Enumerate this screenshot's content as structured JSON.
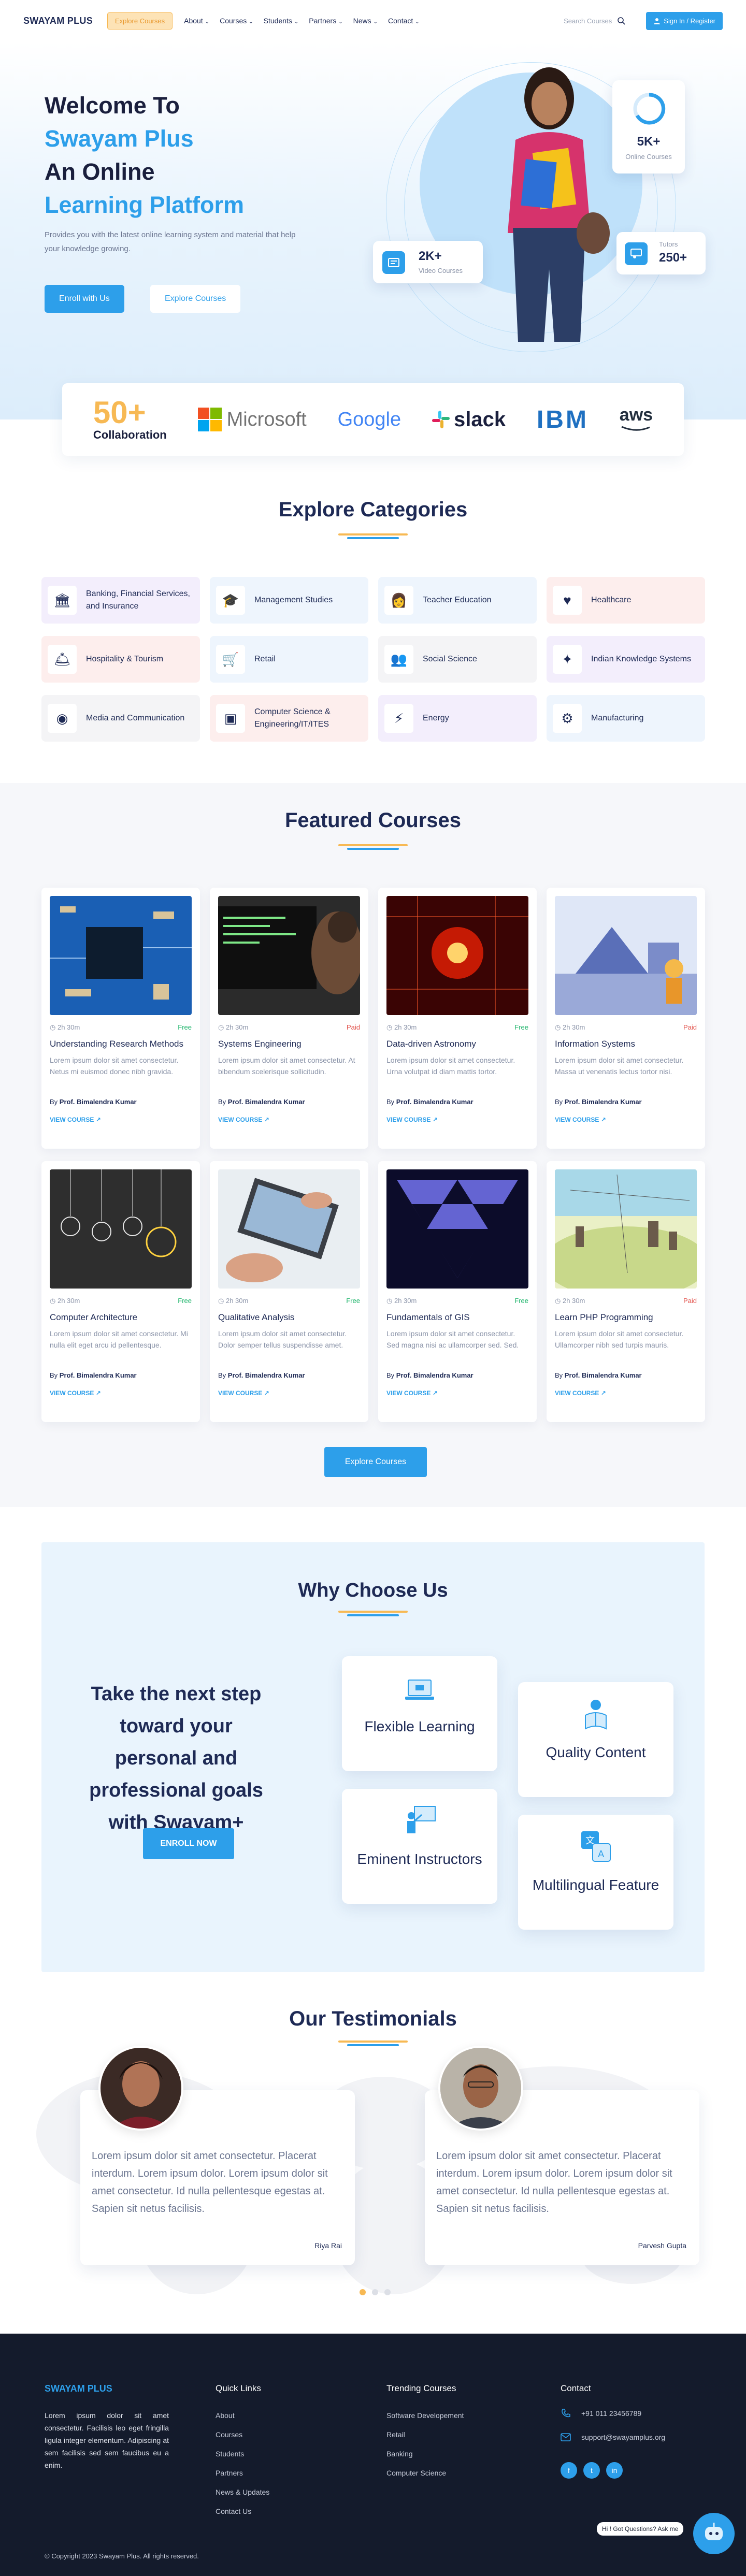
{
  "header": {
    "logo": "SWAYAM PLUS",
    "explore_button": "Explore Courses",
    "nav": [
      "About",
      "Courses",
      "Students",
      "Partners",
      "News",
      "Contact"
    ],
    "search_placeholder": "Search Courses",
    "signin_label": "Sign In / Register"
  },
  "hero": {
    "line1": "Welcome To",
    "line2": "Swayam Plus",
    "line3": "An Online",
    "line4": "Learning Platform",
    "subtitle": "Provides you with the latest online learning system and material that help your knowledge growing.",
    "enroll_button": "Enroll with Us",
    "explore_button": "Explore Courses",
    "stats": {
      "online_value": "5K+",
      "online_label": "Online Courses",
      "video_value": "2K+",
      "video_label": "Video Courses",
      "tutors_label": "Tutors",
      "tutors_value": "250+"
    }
  },
  "partners": {
    "collab_number": "50+",
    "collab_label": "Collaboration",
    "logos": [
      "Microsoft",
      "Google",
      "slack",
      "IBM",
      "aws"
    ]
  },
  "categories": {
    "title": "Explore Categories",
    "items": [
      {
        "label": "Banking, Financial Services, and Insurance",
        "icon": "bank-icon"
      },
      {
        "label": "Management Studies",
        "icon": "graduation-cap-icon"
      },
      {
        "label": "Teacher Education",
        "icon": "teacher-icon"
      },
      {
        "label": "Healthcare",
        "icon": "heart-hand-icon"
      },
      {
        "label": "Hospitality & Tourism",
        "icon": "hospitality-icon"
      },
      {
        "label": "Retail",
        "icon": "cart-icon"
      },
      {
        "label": "Social Science",
        "icon": "people-icon"
      },
      {
        "label": "Indian Knowledge Systems",
        "icon": "knowledge-icon"
      },
      {
        "label": "Media and Communication",
        "icon": "media-icon"
      },
      {
        "label": "Computer Science & Engineering/IT/ITES",
        "icon": "computer-icon"
      },
      {
        "label": "Energy",
        "icon": "bolt-icon"
      },
      {
        "label": "Manufacturing",
        "icon": "gears-icon"
      }
    ]
  },
  "featured": {
    "title": "Featured Courses",
    "cta": "Explore Courses",
    "courses": [
      {
        "duration": "2h 30m",
        "price": "Free",
        "title": "Understanding Research Methods",
        "desc": "Lorem ipsum dolor sit amet consectetur. Netus mi euismod donec nibh gravida.",
        "by": "By",
        "instructor": "Prof. Bimalendra Kumar",
        "view": "VIEW COURSE"
      },
      {
        "duration": "2h 30m",
        "price": "Paid",
        "title": "Systems Engineering",
        "desc": "Lorem ipsum dolor sit amet consectetur. At bibendum scelerisque sollicitudin.",
        "by": "By",
        "instructor": "Prof. Bimalendra Kumar",
        "view": "VIEW COURSE"
      },
      {
        "duration": "2h 30m",
        "price": "Free",
        "title": "Data-driven Astronomy",
        "desc": "Lorem ipsum dolor sit amet consectetur. Urna volutpat id diam mattis tortor.",
        "by": "By",
        "instructor": "Prof. Bimalendra Kumar",
        "view": "VIEW COURSE"
      },
      {
        "duration": "2h 30m",
        "price": "Paid",
        "title": "Information Systems",
        "desc": "Lorem ipsum dolor sit amet consectetur. Massa ut venenatis lectus tortor nisi.",
        "by": "By",
        "instructor": "Prof. Bimalendra Kumar",
        "view": "VIEW COURSE"
      },
      {
        "duration": "2h 30m",
        "price": "Free",
        "title": "Computer Architecture",
        "desc": "Lorem ipsum dolor sit amet consectetur. Mi nulla elit eget arcu id pellentesque.",
        "by": "By",
        "instructor": "Prof. Bimalendra Kumar",
        "view": "VIEW COURSE"
      },
      {
        "duration": "2h 30m",
        "price": "Free",
        "title": "Qualitative Analysis",
        "desc": "Lorem ipsum dolor sit amet consectetur. Dolor semper tellus suspendisse amet.",
        "by": "By",
        "instructor": "Prof. Bimalendra Kumar",
        "view": "VIEW COURSE"
      },
      {
        "duration": "2h 30m",
        "price": "Free",
        "title": "Fundamentals of GIS",
        "desc": "Lorem ipsum dolor sit amet consectetur. Sed magna nisi ac ullamcorper sed. Sed.",
        "by": "By",
        "instructor": "Prof. Bimalendra Kumar",
        "view": "VIEW COURSE"
      },
      {
        "duration": "2h 30m",
        "price": "Paid",
        "title": "Learn PHP Programming",
        "desc": "Lorem ipsum dolor sit amet consectetur. Ullamcorper nibh sed turpis mauris.",
        "by": "By",
        "instructor": "Prof. Bimalendra Kumar",
        "view": "VIEW COURSE"
      }
    ]
  },
  "why": {
    "title": "Why Choose Us",
    "tagline": "Take the next step toward your personal and professional goals with Swayam+",
    "enroll": "ENROLL NOW",
    "tiles": [
      {
        "label": "Flexible Learning",
        "icon": "laptop-icon"
      },
      {
        "label": "Quality Content",
        "icon": "person-book-icon"
      },
      {
        "label": "Eminent Instructors",
        "icon": "instructor-board-icon"
      },
      {
        "label": "Multilingual Feature",
        "icon": "translate-icon"
      }
    ]
  },
  "testimonials": {
    "title": "Our Testimonials",
    "items": [
      {
        "quote": "Lorem ipsum dolor sit amet consectetur. Placerat interdum. Lorem ipsum dolor. Lorem ipsum dolor sit amet consectetur. Id nulla pellentesque egestas at. Sapien sit netus facilisis.",
        "name": "Riya Rai"
      },
      {
        "quote": "Lorem ipsum dolor sit amet consectetur. Placerat interdum. Lorem ipsum dolor. Lorem ipsum dolor sit amet consectetur. Id nulla pellentesque egestas at. Sapien sit netus facilisis.",
        "name": "Parvesh Gupta"
      }
    ]
  },
  "footer": {
    "brand": "SWAYAM PLUS",
    "about": "Lorem ipsum dolor sit amet consectetur. Facilisis leo eget fringilla ligula integer elementum. Adipiscing at sem facilisis sed sem faucibus eu a enim.",
    "quick_title": "Quick Links",
    "quick_links": [
      "About",
      "Courses",
      "Students",
      "Partners",
      "News & Updates",
      "Contact Us"
    ],
    "trending_title": "Trending Courses",
    "trending": [
      "Software Developement",
      "Retail",
      "Banking",
      "Computer Science"
    ],
    "contact_title": "Contact",
    "phone": "+91 011 23456789",
    "email": "support@swayamplus.org",
    "copyright": "© Copyright 2023 Swayam Plus. All rights reserved.",
    "chat": "Hi ! Got Questions? Ask me"
  },
  "colors": {
    "accent": "#2d9fea",
    "navy": "#1e2a55",
    "orange": "#f7b954"
  }
}
